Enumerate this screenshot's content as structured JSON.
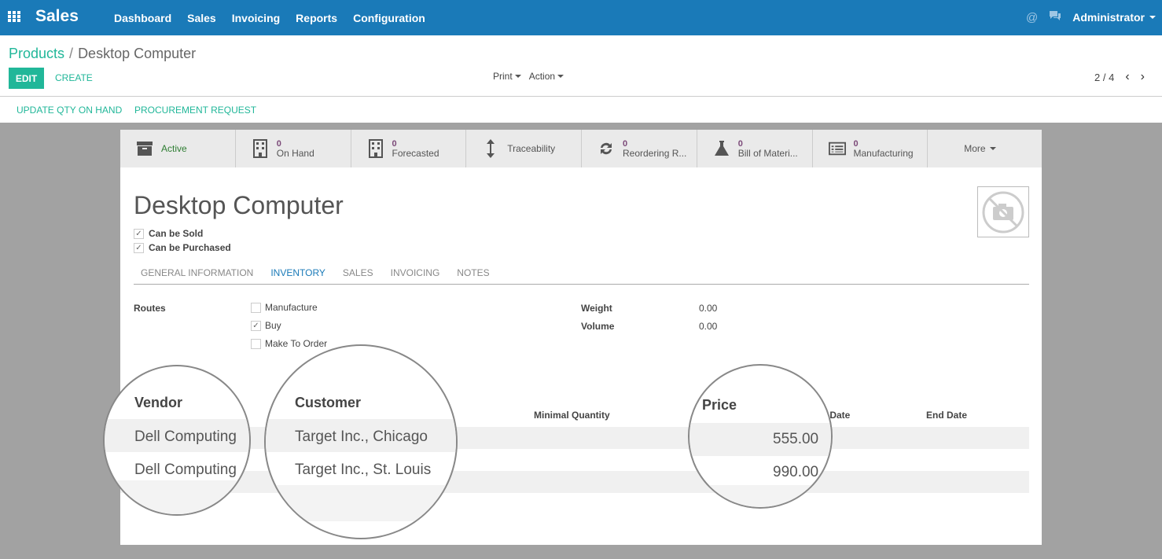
{
  "navbar": {
    "brand": "Sales",
    "menu": [
      "Dashboard",
      "Sales",
      "Invoicing",
      "Reports",
      "Configuration"
    ],
    "user": "Administrator"
  },
  "breadcrumb": {
    "parent": "Products",
    "separator": "/",
    "current": "Desktop Computer"
  },
  "buttons": {
    "edit": "EDIT",
    "create": "CREATE",
    "print": "Print",
    "action": "Action"
  },
  "pager": {
    "text": "2 / 4"
  },
  "statusbar": {
    "update_qty": "UPDATE QTY ON HAND",
    "procurement": "PROCUREMENT REQUEST"
  },
  "smart_buttons": [
    {
      "label": "Active",
      "num": ""
    },
    {
      "label": "On Hand",
      "num": "0"
    },
    {
      "label": "Forecasted",
      "num": "0"
    },
    {
      "label": "Traceability",
      "num": ""
    },
    {
      "label": "Reordering R...",
      "num": "0"
    },
    {
      "label": "Bill of Materi...",
      "num": "0"
    },
    {
      "label": "Manufacturing",
      "num": "0"
    },
    {
      "label": "More",
      "num": ""
    }
  ],
  "product": {
    "name": "Desktop Computer",
    "can_be_sold": "Can be Sold",
    "can_be_purchased": "Can be Purchased"
  },
  "tabs": [
    "GENERAL INFORMATION",
    "INVENTORY",
    "SALES",
    "INVOICING",
    "NOTES"
  ],
  "inventory": {
    "routes_label": "Routes",
    "routes": [
      {
        "label": "Manufacture",
        "checked": false
      },
      {
        "label": "Buy",
        "checked": true
      },
      {
        "label": "Make To Order",
        "checked": false
      }
    ],
    "weight_label": "Weight",
    "weight": "0.00",
    "volume_label": "Volume",
    "volume": "0.00"
  },
  "vendor_table": {
    "headers": {
      "vendor": "Vendor",
      "customer": "Customer",
      "min_qty": "Minimal Quantity",
      "price": "Price",
      "start_date": "t Date",
      "end_date": "End Date"
    },
    "rows": [
      {
        "vendor": "Dell Computing",
        "customer": "Target Inc., Chicago",
        "price": "555.00"
      },
      {
        "vendor": "Dell Computing",
        "customer": "Target Inc., St. Louis",
        "price": "990.00"
      }
    ]
  }
}
